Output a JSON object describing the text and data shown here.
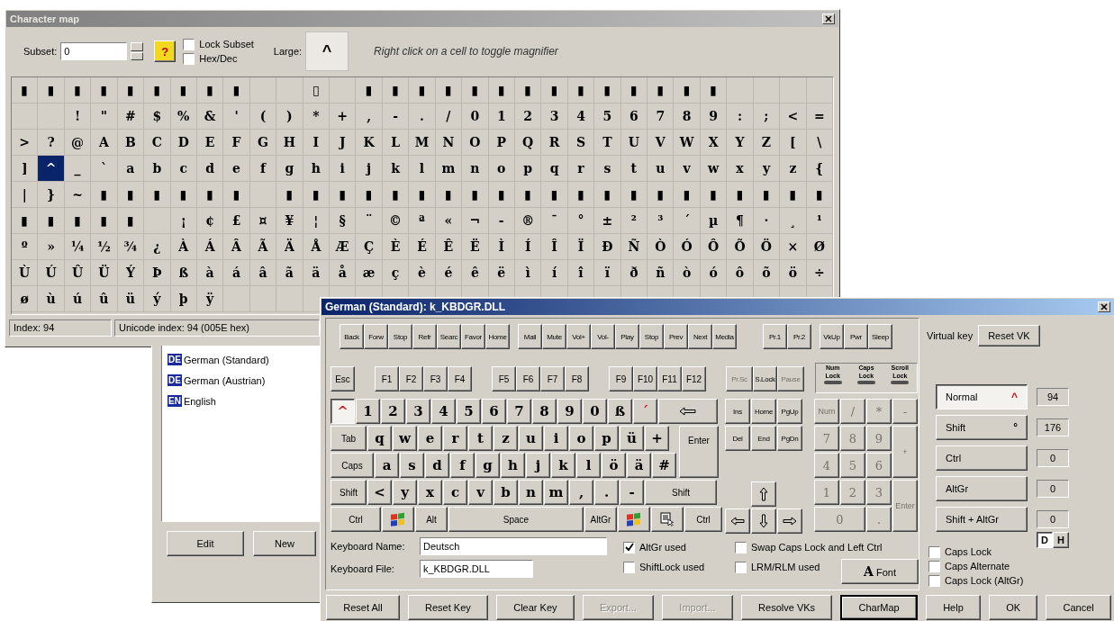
{
  "charmap": {
    "title": "Character map",
    "subset_label": "Subset:",
    "subset_value": "0",
    "help_button": "?",
    "options": [
      {
        "label": "Lock Subset",
        "checked": false
      },
      {
        "label": "Hex/Dec",
        "checked": false
      }
    ],
    "large_label": "Large:",
    "large_char": "^",
    "hint": "Right click on a cell to toggle magnifier",
    "grid": [
      {
        "cells": [
          {
            "char": "▮",
            "selected": false
          },
          {
            "char": "▮",
            "selected": false
          },
          {
            "char": "▮",
            "selected": false
          },
          {
            "char": "▮",
            "selected": false
          },
          {
            "char": "▮",
            "selected": false
          },
          {
            "char": "▮",
            "selected": false
          },
          {
            "char": "▮",
            "selected": false
          },
          {
            "char": "▮",
            "selected": false
          },
          {
            "char": "▮",
            "selected": false
          },
          {
            "selected": false
          },
          {
            "selected": false
          },
          {
            "char": "▯",
            "selected": false
          },
          {
            "selected": false
          },
          {
            "char": "▮",
            "selected": false
          },
          {
            "char": "▮",
            "selected": false
          },
          {
            "char": "▮",
            "selected": false
          },
          {
            "char": "▮",
            "selected": false
          },
          {
            "char": "▮",
            "selected": false
          },
          {
            "char": "▮",
            "selected": false
          },
          {
            "char": "▮",
            "selected": false
          },
          {
            "char": "▮",
            "selected": false
          },
          {
            "char": "▮",
            "selected": false
          },
          {
            "char": "▮",
            "selected": false
          },
          {
            "char": "▮",
            "selected": false
          },
          {
            "char": "▮",
            "selected": false
          },
          {
            "char": "▮",
            "selected": false
          },
          {
            "char": "▮",
            "selected": false
          },
          {
            "selected": false
          },
          {
            "selected": false
          },
          {
            "selected": false
          },
          {
            "selected": false
          }
        ]
      },
      {
        "cells": [
          {
            "selected": false
          },
          {
            "selected": false
          },
          {
            "char": "!",
            "selected": false
          },
          {
            "char": "\"",
            "selected": false
          },
          {
            "char": "#",
            "selected": false
          },
          {
            "char": "$",
            "selected": false
          },
          {
            "char": "%",
            "selected": false
          },
          {
            "char": "&",
            "selected": false
          },
          {
            "char": "'",
            "selected": false
          },
          {
            "char": "(",
            "selected": false
          },
          {
            "char": ")",
            "selected": false
          },
          {
            "char": "*",
            "selected": false
          },
          {
            "char": "+",
            "selected": false
          },
          {
            "char": ",",
            "selected": false
          },
          {
            "char": "-",
            "selected": false
          },
          {
            "char": ".",
            "selected": false
          },
          {
            "char": "/",
            "selected": false
          },
          {
            "char": "0",
            "selected": false
          },
          {
            "char": "1",
            "selected": false
          },
          {
            "char": "2",
            "selected": false
          },
          {
            "char": "3",
            "selected": false
          },
          {
            "char": "4",
            "selected": false
          },
          {
            "char": "5",
            "selected": false
          },
          {
            "char": "6",
            "selected": false
          },
          {
            "char": "7",
            "selected": false
          },
          {
            "char": "8",
            "selected": false
          },
          {
            "char": "9",
            "selected": false
          },
          {
            "char": ":",
            "selected": false
          },
          {
            "char": ";",
            "selected": false
          },
          {
            "char": "<",
            "selected": false
          },
          {
            "char": "=",
            "selected": false
          }
        ]
      },
      {
        "cells": [
          {
            "char": ">",
            "selected": false
          },
          {
            "char": "?",
            "selected": false
          },
          {
            "char": "@",
            "selected": false
          },
          {
            "char": "A",
            "selected": false
          },
          {
            "char": "B",
            "selected": false
          },
          {
            "char": "C",
            "selected": false
          },
          {
            "char": "D",
            "selected": false
          },
          {
            "char": "E",
            "selected": false
          },
          {
            "char": "F",
            "selected": false
          },
          {
            "char": "G",
            "selected": false
          },
          {
            "char": "H",
            "selected": false
          },
          {
            "char": "I",
            "selected": false
          },
          {
            "char": "J",
            "selected": false
          },
          {
            "char": "K",
            "selected": false
          },
          {
            "char": "L",
            "selected": false
          },
          {
            "char": "M",
            "selected": false
          },
          {
            "char": "N",
            "selected": false
          },
          {
            "char": "O",
            "selected": false
          },
          {
            "char": "P",
            "selected": false
          },
          {
            "char": "Q",
            "selected": false
          },
          {
            "char": "R",
            "selected": false
          },
          {
            "char": "S",
            "selected": false
          },
          {
            "char": "T",
            "selected": false
          },
          {
            "char": "U",
            "selected": false
          },
          {
            "char": "V",
            "selected": false
          },
          {
            "char": "W",
            "selected": false
          },
          {
            "char": "X",
            "selected": false
          },
          {
            "char": "Y",
            "selected": false
          },
          {
            "char": "Z",
            "selected": false
          },
          {
            "char": "[",
            "selected": false
          },
          {
            "char": "\\",
            "selected": false
          }
        ]
      },
      {
        "cells": [
          {
            "char": "]",
            "selected": false
          },
          {
            "char": "^",
            "selected": true
          },
          {
            "char": "_",
            "selected": false
          },
          {
            "char": "`",
            "selected": false
          },
          {
            "char": "a",
            "selected": false
          },
          {
            "char": "b",
            "selected": false
          },
          {
            "char": "c",
            "selected": false
          },
          {
            "char": "d",
            "selected": false
          },
          {
            "char": "e",
            "selected": false
          },
          {
            "char": "f",
            "selected": false
          },
          {
            "char": "g",
            "selected": false
          },
          {
            "char": "h",
            "selected": false
          },
          {
            "char": "i",
            "selected": false
          },
          {
            "char": "j",
            "selected": false
          },
          {
            "char": "k",
            "selected": false
          },
          {
            "char": "l",
            "selected": false
          },
          {
            "char": "m",
            "selected": false
          },
          {
            "char": "n",
            "selected": false
          },
          {
            "char": "o",
            "selected": false
          },
          {
            "char": "p",
            "selected": false
          },
          {
            "char": "q",
            "selected": false
          },
          {
            "char": "r",
            "selected": false
          },
          {
            "char": "s",
            "selected": false
          },
          {
            "char": "t",
            "selected": false
          },
          {
            "char": "u",
            "selected": false
          },
          {
            "char": "v",
            "selected": false
          },
          {
            "char": "w",
            "selected": false
          },
          {
            "char": "x",
            "selected": false
          },
          {
            "char": "y",
            "selected": false
          },
          {
            "char": "z",
            "selected": false
          },
          {
            "char": "{",
            "selected": false
          }
        ]
      },
      {
        "cells": [
          {
            "char": "|",
            "selected": false
          },
          {
            "char": "}",
            "selected": false
          },
          {
            "char": "~",
            "selected": false
          },
          {
            "char": "▮",
            "selected": false
          },
          {
            "char": "▮",
            "selected": false
          },
          {
            "char": "▮",
            "selected": false
          },
          {
            "char": "▮",
            "selected": false
          },
          {
            "char": "▮",
            "selected": false
          },
          {
            "char": "▮",
            "selected": false
          },
          {
            "selected": false
          },
          {
            "char": "▮",
            "selected": false
          },
          {
            "char": "▮",
            "selected": false
          },
          {
            "char": "▮",
            "selected": false
          },
          {
            "char": "▮",
            "selected": false
          },
          {
            "char": "▮",
            "selected": false
          },
          {
            "char": "▮",
            "selected": false
          },
          {
            "char": "▮",
            "selected": false
          },
          {
            "char": "▮",
            "selected": false
          },
          {
            "char": "▮",
            "selected": false
          },
          {
            "char": "▮",
            "selected": false
          },
          {
            "char": "▮",
            "selected": false
          },
          {
            "char": "▮",
            "selected": false
          },
          {
            "char": "▮",
            "selected": false
          },
          {
            "char": "▮",
            "selected": false
          },
          {
            "char": "▮",
            "selected": false
          },
          {
            "char": "▮",
            "selected": false
          },
          {
            "char": "▮",
            "selected": false
          },
          {
            "char": "▮",
            "selected": false
          },
          {
            "char": "▮",
            "selected": false
          },
          {
            "char": "▮",
            "selected": false
          },
          {
            "char": "▮",
            "selected": false
          }
        ]
      },
      {
        "cells": [
          {
            "char": "▮",
            "selected": false
          },
          {
            "char": "▮",
            "selected": false
          },
          {
            "char": "▮",
            "selected": false
          },
          {
            "char": "▮",
            "selected": false
          },
          {
            "char": "▮",
            "selected": false
          },
          {
            "selected": false
          },
          {
            "char": "¡",
            "selected": false
          },
          {
            "char": "¢",
            "selected": false
          },
          {
            "char": "£",
            "selected": false
          },
          {
            "char": "¤",
            "selected": false
          },
          {
            "char": "¥",
            "selected": false
          },
          {
            "char": "¦",
            "selected": false
          },
          {
            "char": "§",
            "selected": false
          },
          {
            "char": "¨",
            "selected": false
          },
          {
            "char": "©",
            "selected": false
          },
          {
            "char": "ª",
            "selected": false
          },
          {
            "char": "«",
            "selected": false
          },
          {
            "char": "¬",
            "selected": false
          },
          {
            "char": "-",
            "selected": false
          },
          {
            "char": "®",
            "selected": false
          },
          {
            "char": "¯",
            "selected": false
          },
          {
            "char": "°",
            "selected": false
          },
          {
            "char": "±",
            "selected": false
          },
          {
            "char": "²",
            "selected": false
          },
          {
            "char": "³",
            "selected": false
          },
          {
            "char": "´",
            "selected": false
          },
          {
            "char": "µ",
            "selected": false
          },
          {
            "char": "¶",
            "selected": false
          },
          {
            "char": "·",
            "selected": false
          },
          {
            "char": "¸",
            "selected": false
          },
          {
            "char": "¹",
            "selected": false
          }
        ]
      },
      {
        "cells": [
          {
            "char": "º",
            "selected": false
          },
          {
            "char": "»",
            "selected": false
          },
          {
            "char": "¼",
            "selected": false
          },
          {
            "char": "½",
            "selected": false
          },
          {
            "char": "¾",
            "selected": false
          },
          {
            "char": "¿",
            "selected": false
          },
          {
            "char": "À",
            "selected": false
          },
          {
            "char": "Á",
            "selected": false
          },
          {
            "char": "Â",
            "selected": false
          },
          {
            "char": "Ã",
            "selected": false
          },
          {
            "char": "Ä",
            "selected": false
          },
          {
            "char": "Å",
            "selected": false
          },
          {
            "char": "Æ",
            "selected": false
          },
          {
            "char": "Ç",
            "selected": false
          },
          {
            "char": "È",
            "selected": false
          },
          {
            "char": "É",
            "selected": false
          },
          {
            "char": "Ê",
            "selected": false
          },
          {
            "char": "Ë",
            "selected": false
          },
          {
            "char": "Ì",
            "selected": false
          },
          {
            "char": "Í",
            "selected": false
          },
          {
            "char": "Î",
            "selected": false
          },
          {
            "char": "Ï",
            "selected": false
          },
          {
            "char": "Ð",
            "selected": false
          },
          {
            "char": "Ñ",
            "selected": false
          },
          {
            "char": "Ò",
            "selected": false
          },
          {
            "char": "Ó",
            "selected": false
          },
          {
            "char": "Ô",
            "selected": false
          },
          {
            "char": "Õ",
            "selected": false
          },
          {
            "char": "Ö",
            "selected": false
          },
          {
            "char": "×",
            "selected": false
          },
          {
            "char": "Ø",
            "selected": false
          }
        ]
      },
      {
        "cells": [
          {
            "char": "Ù",
            "selected": false
          },
          {
            "char": "Ú",
            "selected": false
          },
          {
            "char": "Û",
            "selected": false
          },
          {
            "char": "Ü",
            "selected": false
          },
          {
            "char": "Ý",
            "selected": false
          },
          {
            "char": "Þ",
            "selected": false
          },
          {
            "char": "ß",
            "selected": false
          },
          {
            "char": "à",
            "selected": false
          },
          {
            "char": "á",
            "selected": false
          },
          {
            "char": "â",
            "selected": false
          },
          {
            "char": "ã",
            "selected": false
          },
          {
            "char": "ä",
            "selected": false
          },
          {
            "char": "å",
            "selected": false
          },
          {
            "char": "æ",
            "selected": false
          },
          {
            "char": "ç",
            "selected": false
          },
          {
            "char": "è",
            "selected": false
          },
          {
            "char": "é",
            "selected": false
          },
          {
            "char": "ê",
            "selected": false
          },
          {
            "char": "ë",
            "selected": false
          },
          {
            "char": "ì",
            "selected": false
          },
          {
            "char": "í",
            "selected": false
          },
          {
            "char": "î",
            "selected": false
          },
          {
            "char": "ï",
            "selected": false
          },
          {
            "char": "ð",
            "selected": false
          },
          {
            "char": "ñ",
            "selected": false
          },
          {
            "char": "ò",
            "selected": false
          },
          {
            "char": "ó",
            "selected": false
          },
          {
            "char": "ô",
            "selected": false
          },
          {
            "char": "õ",
            "selected": false
          },
          {
            "char": "ö",
            "selected": false
          },
          {
            "char": "÷",
            "selected": false
          }
        ]
      },
      {
        "cells": [
          {
            "char": "ø",
            "selected": false
          },
          {
            "char": "ù",
            "selected": false
          },
          {
            "char": "ú",
            "selected": false
          },
          {
            "char": "û",
            "selected": false
          },
          {
            "char": "ü",
            "selected": false
          },
          {
            "char": "ý",
            "selected": false
          },
          {
            "char": "þ",
            "selected": false
          },
          {
            "char": "ÿ",
            "selected": false
          }
        ]
      }
    ],
    "status": [
      "Index: 94",
      "Unicode index: 94 (005E hex)"
    ]
  },
  "layouts_window": {
    "items": [
      {
        "badge": "DE",
        "label": "German (Standard)"
      },
      {
        "badge": "DE",
        "label": "German (Austrian)"
      },
      {
        "badge": "EN",
        "label": "English"
      }
    ],
    "buttons": [
      "Edit",
      "New"
    ]
  },
  "keyboard_window": {
    "title": "German (Standard): k_KBDGR.DLL",
    "media_groups": [
      [
        "Back",
        "Forw",
        "Stop",
        "Refr",
        "Searc",
        "Favor",
        "Home"
      ],
      [
        "Mail",
        "Mute",
        "Vol+",
        "Vol-",
        "Play",
        "Stop",
        "Prev",
        "Next",
        "Media"
      ],
      [
        "Pr.1",
        "Pr.2"
      ],
      [
        "VkUp",
        "Pwr",
        "Sleep"
      ]
    ],
    "esc": "Esc",
    "f_groups": [
      [
        "F1",
        "F2",
        "F3",
        "F4"
      ],
      [
        "F5",
        "F6",
        "F7",
        "F8"
      ],
      [
        "F9",
        "F10",
        "F11",
        "F12"
      ]
    ],
    "sys_keys": [
      {
        "label": "Pr.Sc",
        "disabled": true
      },
      {
        "label": "S.Lock",
        "disabled": false
      },
      {
        "label": "Pause",
        "disabled": true
      }
    ],
    "locks": [
      {
        "label": "Num",
        "label2": "Lock",
        "on": false
      },
      {
        "label": "Caps",
        "label2": "Lock",
        "on": false
      },
      {
        "label": "Scroll",
        "label2": "Lock",
        "on": false
      }
    ],
    "main_rows": [
      [
        {
          "label": "^",
          "kind": "char",
          "selected": true,
          "dead": true
        },
        {
          "label": "1",
          "kind": "char",
          "selected": false,
          "dead": false
        },
        {
          "label": "2",
          "kind": "char",
          "selected": false,
          "dead": false
        },
        {
          "label": "3",
          "kind": "char",
          "selected": false,
          "dead": false
        },
        {
          "label": "4",
          "kind": "char",
          "selected": false,
          "dead": false
        },
        {
          "label": "5",
          "kind": "char",
          "selected": false,
          "dead": false
        },
        {
          "label": "6",
          "kind": "char",
          "selected": false,
          "dead": false
        },
        {
          "label": "7",
          "kind": "char",
          "selected": false,
          "dead": false
        },
        {
          "label": "8",
          "kind": "char",
          "selected": false,
          "dead": false
        },
        {
          "label": "9",
          "kind": "char",
          "selected": false,
          "dead": false
        },
        {
          "label": "0",
          "kind": "char",
          "selected": false,
          "dead": false
        },
        {
          "label": "ß",
          "kind": "char",
          "selected": false,
          "dead": false
        },
        {
          "label": "´",
          "kind": "char",
          "selected": false,
          "dead": true
        },
        {
          "kind": "backspace",
          "selected": false
        }
      ],
      [
        {
          "label": "Tab",
          "kind": "tab",
          "selected": false,
          "dead": false
        },
        {
          "label": "q",
          "kind": "char",
          "selected": false,
          "dead": false
        },
        {
          "label": "w",
          "kind": "char",
          "selected": false,
          "dead": false
        },
        {
          "label": "e",
          "kind": "char",
          "selected": false,
          "dead": false
        },
        {
          "label": "r",
          "kind": "char",
          "selected": false,
          "dead": false
        },
        {
          "label": "t",
          "kind": "char",
          "selected": false,
          "dead": false
        },
        {
          "label": "z",
          "kind": "char",
          "selected": false,
          "dead": false
        },
        {
          "label": "u",
          "kind": "char",
          "selected": false,
          "dead": false
        },
        {
          "label": "i",
          "kind": "char",
          "selected": false,
          "dead": false
        },
        {
          "label": "o",
          "kind": "char",
          "selected": false,
          "dead": false
        },
        {
          "label": "p",
          "kind": "char",
          "selected": false,
          "dead": false
        },
        {
          "label": "ü",
          "kind": "char",
          "selected": false,
          "dead": false
        },
        {
          "label": "+",
          "kind": "char",
          "selected": false,
          "dead": false
        }
      ],
      [
        {
          "label": "Caps",
          "kind": "caps",
          "selected": false,
          "dead": false
        },
        {
          "label": "a",
          "kind": "char",
          "selected": false,
          "dead": false
        },
        {
          "label": "s",
          "kind": "char",
          "selected": false,
          "dead": false
        },
        {
          "label": "d",
          "kind": "char",
          "selected": false,
          "dead": false
        },
        {
          "label": "f",
          "kind": "char",
          "selected": false,
          "dead": false
        },
        {
          "label": "g",
          "kind": "char",
          "selected": false,
          "dead": false
        },
        {
          "label": "h",
          "kind": "char",
          "selected": false,
          "dead": false
        },
        {
          "label": "j",
          "kind": "char",
          "selected": false,
          "dead": false
        },
        {
          "label": "k",
          "kind": "char",
          "selected": false,
          "dead": false
        },
        {
          "label": "l",
          "kind": "char",
          "selected": false,
          "dead": false
        },
        {
          "label": "ö",
          "kind": "char",
          "selected": false,
          "dead": false
        },
        {
          "label": "ä",
          "kind": "char",
          "selected": false,
          "dead": false
        },
        {
          "label": "#",
          "kind": "char",
          "selected": false,
          "dead": false
        }
      ],
      [
        {
          "label": "Shift",
          "kind": "shift",
          "selected": false,
          "dead": false
        },
        {
          "label": "<",
          "kind": "char",
          "selected": false,
          "dead": false
        },
        {
          "label": "y",
          "kind": "char",
          "selected": false,
          "dead": false
        },
        {
          "label": "x",
          "kind": "char",
          "selected": false,
          "dead": false
        },
        {
          "label": "c",
          "kind": "char",
          "selected": false,
          "dead": false
        },
        {
          "label": "v",
          "kind": "char",
          "selected": false,
          "dead": false
        },
        {
          "label": "b",
          "kind": "char",
          "selected": false,
          "dead": false
        },
        {
          "label": "n",
          "kind": "char",
          "selected": false,
          "dead": false
        },
        {
          "label": "m",
          "kind": "char",
          "selected": false,
          "dead": false
        },
        {
          "label": ",",
          "kind": "char",
          "selected": false,
          "dead": false
        },
        {
          "label": ".",
          "kind": "char",
          "selected": false,
          "dead": false
        },
        {
          "label": "-",
          "kind": "char",
          "selected": false,
          "dead": false
        },
        {
          "label": "Shift",
          "kind": "rshift",
          "selected": false,
          "dead": false
        }
      ],
      [
        {
          "label": "Ctrl",
          "kind": "ctrl",
          "selected": false,
          "dead": false
        },
        {
          "kind": "logo",
          "selected": false
        },
        {
          "label": "Alt",
          "kind": "alt",
          "selected": false,
          "dead": false
        },
        {
          "label": "Space",
          "kind": "space",
          "selected": false,
          "dead": false
        },
        {
          "label": "AltGr",
          "kind": "altgr",
          "selected": false,
          "dead": false
        },
        {
          "kind": "logo",
          "selected": false
        },
        {
          "kind": "menu",
          "selected": false
        },
        {
          "label": "Ctrl",
          "kind": "rctrl",
          "selected": false,
          "dead": false
        }
      ]
    ],
    "enter": "Enter",
    "nav_rows": [
      [
        "Ins",
        "Home",
        "PgUp"
      ],
      [
        "Del",
        "End",
        "PgDn"
      ]
    ],
    "numpad": [
      {
        "label": "Num",
        "kind": "key",
        "disabled": true
      },
      {
        "label": "/",
        "kind": "key",
        "disabled": true
      },
      {
        "label": "*",
        "kind": "key",
        "disabled": true
      },
      {
        "label": "-",
        "kind": "key",
        "disabled": true
      },
      {
        "label": "7",
        "kind": "key",
        "disabled": true
      },
      {
        "label": "8",
        "kind": "key",
        "disabled": true
      },
      {
        "label": "9",
        "kind": "key",
        "disabled": true
      },
      {
        "label": "+",
        "kind": "tall",
        "disabled": true
      },
      {
        "label": "4",
        "kind": "key",
        "disabled": true
      },
      {
        "label": "5",
        "kind": "key",
        "disabled": true
      },
      {
        "label": "6",
        "kind": "key",
        "disabled": true
      },
      {
        "label": "1",
        "kind": "key",
        "disabled": true
      },
      {
        "label": "2",
        "kind": "key",
        "disabled": true
      },
      {
        "label": "3",
        "kind": "key",
        "disabled": true
      },
      {
        "label": "Enter",
        "kind": "tall",
        "disabled": true
      },
      {
        "label": "0",
        "kind": "wide",
        "disabled": true
      },
      {
        "label": ".",
        "kind": "key",
        "disabled": true
      }
    ],
    "name_label": "Keyboard Name:",
    "name_value": "Deutsch",
    "file_label": "Keyboard File:",
    "file_value": "k_KBDGR.DLL",
    "flags": [
      {
        "label": "AltGr used",
        "checked": true
      },
      {
        "label": "ShiftLock used",
        "checked": false
      },
      {
        "label": "Swap Caps Lock and Left Ctrl",
        "checked": false
      },
      {
        "label": "LRM/RLM used",
        "checked": false
      }
    ],
    "font_button": {
      "glyph": "A",
      "label": "Font"
    },
    "virtual_key_label": "Virtual key",
    "reset_vk": "Reset VK",
    "shift_states": [
      {
        "label": "Normal",
        "char": "^",
        "value": "94",
        "selected": true
      },
      {
        "label": "Shift",
        "char": "°",
        "value": "176",
        "selected": false
      },
      {
        "label": "Ctrl",
        "value": "0",
        "selected": false
      },
      {
        "label": "AltGr",
        "value": "0",
        "selected": false
      },
      {
        "label": "Shift + AltGr",
        "value": "0",
        "selected": false
      }
    ],
    "base": [
      {
        "label": "D",
        "selected": true
      },
      {
        "label": "H",
        "selected": false
      }
    ],
    "caps_options": [
      {
        "label": "Caps Lock",
        "checked": false
      },
      {
        "label": "Caps Alternate",
        "checked": false
      },
      {
        "label": "Caps Lock (AltGr)",
        "checked": false
      }
    ],
    "buttons": [
      {
        "label": "Reset All",
        "disabled": false,
        "default": false
      },
      {
        "label": "Reset Key",
        "disabled": false,
        "default": false
      },
      {
        "label": "Clear Key",
        "disabled": false,
        "default": false
      },
      {
        "label": "Export...",
        "disabled": true,
        "default": false
      },
      {
        "label": "Import...",
        "disabled": true,
        "default": false
      },
      {
        "label": "Resolve VKs",
        "disabled": false,
        "default": false
      },
      {
        "label": "CharMap",
        "disabled": false,
        "default": true
      },
      {
        "label": "Help",
        "disabled": false,
        "default": false
      },
      {
        "label": "OK",
        "disabled": false,
        "default": false
      },
      {
        "label": "Cancel",
        "disabled": false,
        "default": false
      }
    ]
  }
}
